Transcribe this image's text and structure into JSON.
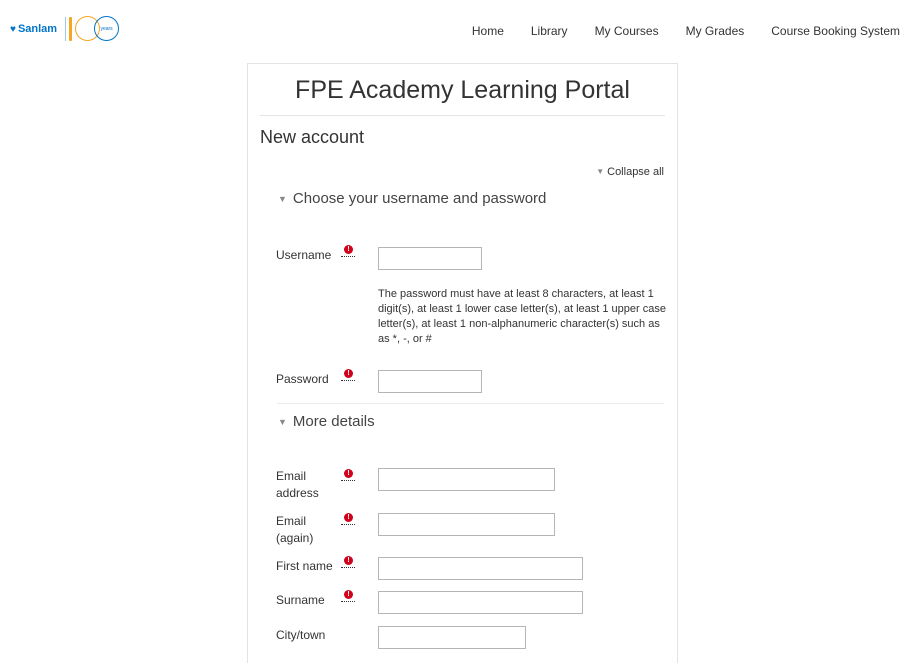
{
  "brand": {
    "logo_text": "Sanlam",
    "anniversary_text": "years"
  },
  "nav": {
    "items": [
      "Home",
      "Library",
      "My Courses",
      "My Grades",
      "Course Booking System"
    ]
  },
  "site_title": "FPE Academy Learning Portal",
  "page_heading": "New account",
  "collapse_all": "Collapse all",
  "sections": {
    "credentials": "Choose your username and password",
    "details": "More details"
  },
  "fields": {
    "username": {
      "label": "Username",
      "value": "",
      "required": true
    },
    "password_help": "The password must have at least 8 characters, at least 1 digit(s), at least 1 lower case letter(s), at least 1 upper case letter(s), at least 1 non-alphanumeric character(s) such as as *, -, or #",
    "password": {
      "label": "Password",
      "value": "",
      "required": true
    },
    "email": {
      "label_line1": "Email",
      "label_line2": "address",
      "value": "",
      "required": true
    },
    "email_again": {
      "label_line1": "Email",
      "label_line2": "(again)",
      "value": "",
      "required": true
    },
    "first_name": {
      "label": "First name",
      "value": "",
      "required": true
    },
    "surname": {
      "label": "Surname",
      "value": "",
      "required": true
    },
    "city": {
      "label": "City/town",
      "value": "",
      "required": false
    }
  },
  "icons": {
    "required": "exclamation-circle-icon",
    "caret": "caret-down-icon"
  },
  "colors": {
    "brand_blue": "#0075c9",
    "brand_orange": "#f5a623",
    "required_red": "#d0021b"
  }
}
